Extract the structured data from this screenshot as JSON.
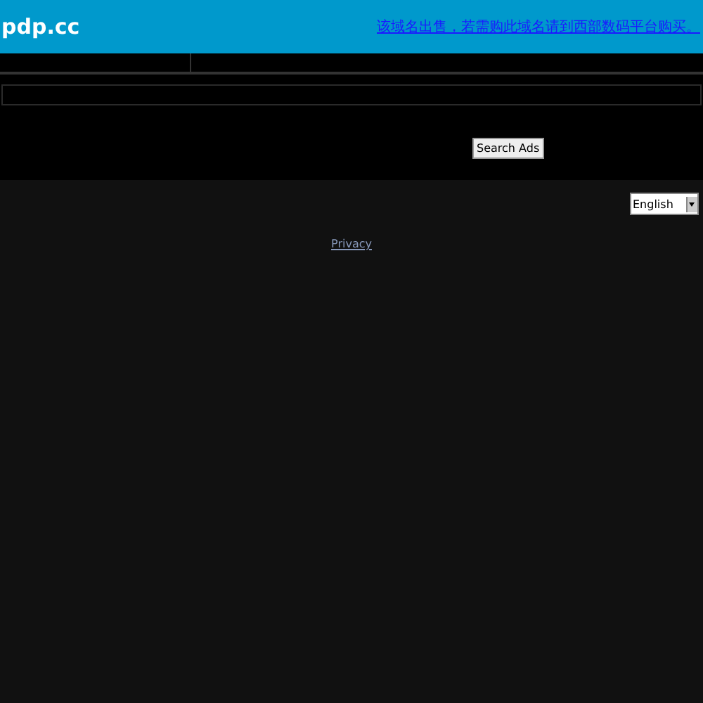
{
  "header": {
    "logo": "pdp.cc",
    "sale_link": "该域名出售，若需购此域名请到西部数码平台购买。"
  },
  "search": {
    "button": "Search Ads"
  },
  "footer": {
    "language": "English",
    "privacy_link": "Privacy"
  }
}
